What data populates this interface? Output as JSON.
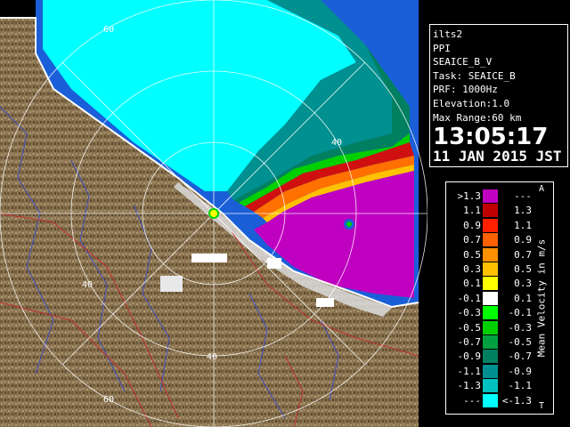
{
  "info": {
    "station": "ilts2",
    "mode": "PPI",
    "volume": "SEAICE_B_V",
    "task": "Task: SEAICE_B",
    "prf": "PRF: 1000Hz",
    "elevation": "Elevation:1.0",
    "max_range": "Max Range:60 km",
    "time": "13:05:17",
    "date": "11 JAN 2015 JST"
  },
  "legend": {
    "title": "Mean Velocity in m/s",
    "corner_top": "A",
    "corner_bottom": "T",
    "rows": [
      {
        "lo": ">1.3",
        "hi": "---",
        "color": "#c000c0"
      },
      {
        "lo": "1.1",
        "hi": "1.3",
        "color": "#c00000"
      },
      {
        "lo": "0.9",
        "hi": "1.1",
        "color": "#ff2000"
      },
      {
        "lo": "0.7",
        "hi": "0.9",
        "color": "#ff6000"
      },
      {
        "lo": "0.5",
        "hi": "0.7",
        "color": "#ff9000"
      },
      {
        "lo": "0.3",
        "hi": "0.5",
        "color": "#ffc000"
      },
      {
        "lo": "0.1",
        "hi": "0.3",
        "color": "#ffff00"
      },
      {
        "lo": "-0.1",
        "hi": "0.1",
        "color": "#ffffff"
      },
      {
        "lo": "-0.3",
        "hi": "-0.1",
        "color": "#00ff00"
      },
      {
        "lo": "-0.5",
        "hi": "-0.3",
        "color": "#00d000"
      },
      {
        "lo": "-0.7",
        "hi": "-0.5",
        "color": "#00a040"
      },
      {
        "lo": "-0.9",
        "hi": "-0.7",
        "color": "#008060"
      },
      {
        "lo": "-1.1",
        "hi": "-0.9",
        "color": "#009090"
      },
      {
        "lo": "-1.3",
        "hi": "-1.1",
        "color": "#00c0c0"
      },
      {
        "lo": "---",
        "hi": "<-1.3",
        "color": "#00ffff"
      }
    ]
  },
  "range_rings": {
    "unit": "km",
    "labels": [
      "40",
      "40",
      "40",
      "60",
      "60"
    ]
  },
  "colors": {
    "land": "#8a7350",
    "land_dark": "#5e4a2e",
    "sea_ice_far": "#00ffff",
    "coastline": "#ffffff",
    "rivers": "#4050c0",
    "roads": "#c03030",
    "rings": "#ffffff"
  }
}
